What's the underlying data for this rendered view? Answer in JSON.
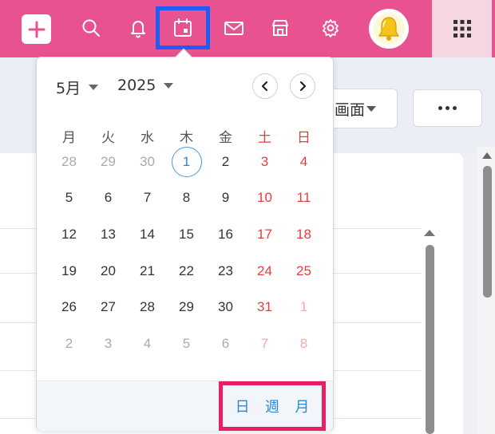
{
  "topbar": {
    "background": "#e85291",
    "icons": [
      "plus-icon",
      "search-icon",
      "bell-icon",
      "calendar-icon",
      "mail-icon",
      "store-icon",
      "gear-icon",
      "bell-avatar",
      "grid-icon"
    ]
  },
  "background_app": {
    "view_select_label": "画面"
  },
  "datepicker": {
    "month_label": "5月",
    "year_label": "2025",
    "weekdays": [
      "月",
      "火",
      "水",
      "木",
      "金",
      "土",
      "日"
    ],
    "weeks": [
      [
        "28",
        "29",
        "30",
        "1",
        "2",
        "3",
        "4"
      ],
      [
        "5",
        "6",
        "7",
        "8",
        "9",
        "10",
        "11"
      ],
      [
        "12",
        "13",
        "14",
        "15",
        "16",
        "17",
        "18"
      ],
      [
        "19",
        "20",
        "21",
        "22",
        "23",
        "24",
        "25"
      ],
      [
        "26",
        "27",
        "28",
        "29",
        "30",
        "31",
        "1"
      ],
      [
        "2",
        "3",
        "4",
        "5",
        "6",
        "7",
        "8"
      ]
    ],
    "today": "1",
    "view_modes": [
      "日",
      "週",
      "月"
    ]
  }
}
